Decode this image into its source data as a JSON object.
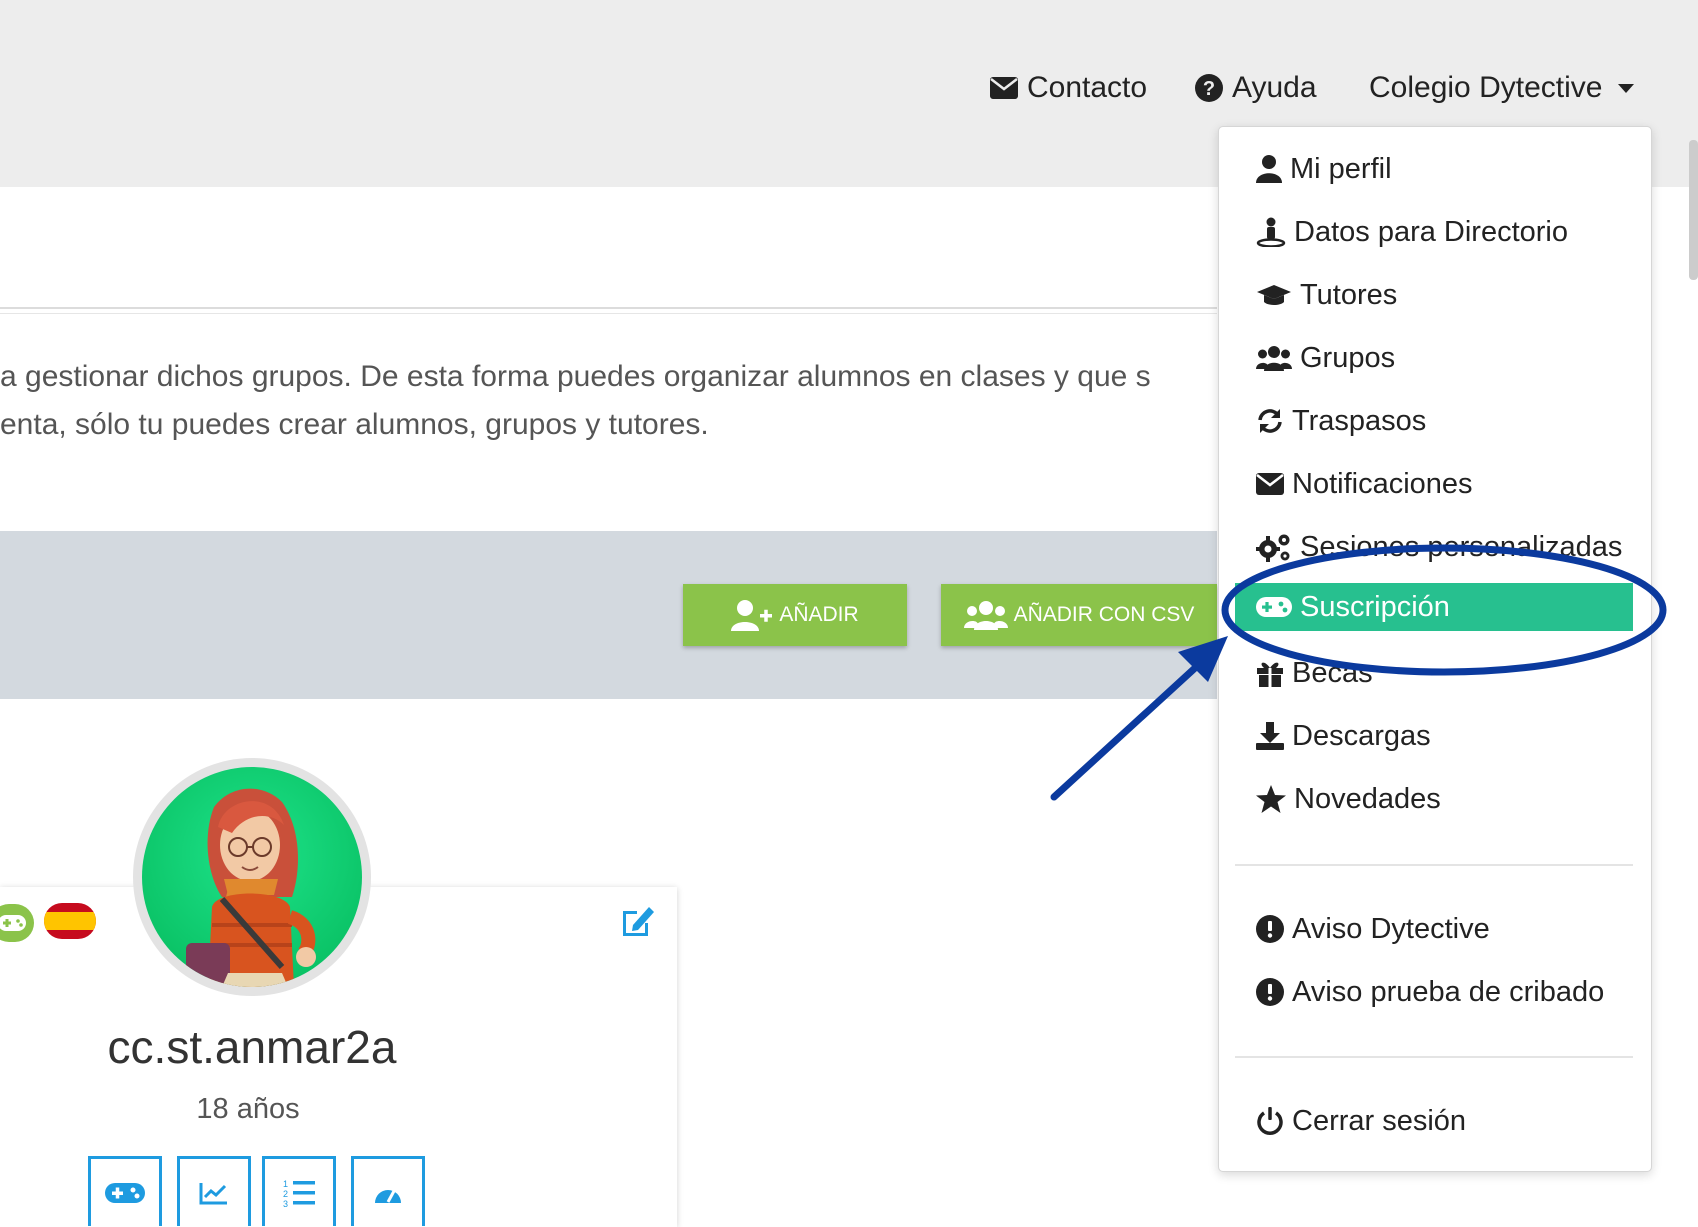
{
  "nav": {
    "contact_label": "Contacto",
    "help_label": "Ayuda",
    "account_label": "Colegio Dytective"
  },
  "description": {
    "line1": "a gestionar dichos grupos. De esta forma puedes organizar alumnos en clases y que s",
    "line2": "enta, sólo tu puedes crear alumnos, grupos y tutores."
  },
  "actions": {
    "add_label": "AÑADIR",
    "add_csv_label": "AÑADIR CON CSV"
  },
  "student": {
    "username": "cc.st.anmar2a",
    "age": "18 años"
  },
  "menu": {
    "items": [
      {
        "label": "Mi perfil",
        "icon": "user-icon"
      },
      {
        "label": "Datos para Directorio",
        "icon": "directory-person-icon"
      },
      {
        "label": "Tutores",
        "icon": "graduation-cap-icon"
      },
      {
        "label": "Grupos",
        "icon": "users-icon"
      },
      {
        "label": "Traspasos",
        "icon": "sync-icon"
      },
      {
        "label": "Notificaciones",
        "icon": "envelope-icon"
      },
      {
        "label": "Sesiones personalizadas",
        "icon": "cogs-icon"
      },
      {
        "label": "Suscripción",
        "icon": "gamepad-icon",
        "active": true
      },
      {
        "label": "Becas",
        "icon": "gift-icon"
      },
      {
        "label": "Descargas",
        "icon": "download-icon"
      },
      {
        "label": "Novedades",
        "icon": "star-icon"
      },
      {
        "label": "Aviso Dytective",
        "icon": "exclamation-circle-icon"
      },
      {
        "label": "Aviso prueba de cribado",
        "icon": "exclamation-circle-icon"
      },
      {
        "label": "Cerrar sesión",
        "icon": "power-icon"
      }
    ]
  },
  "colors": {
    "accent_green": "#8bc34a",
    "active_teal": "#27c08f",
    "annotation_blue": "#0b3a9e",
    "tile_blue": "#1e9be0"
  }
}
